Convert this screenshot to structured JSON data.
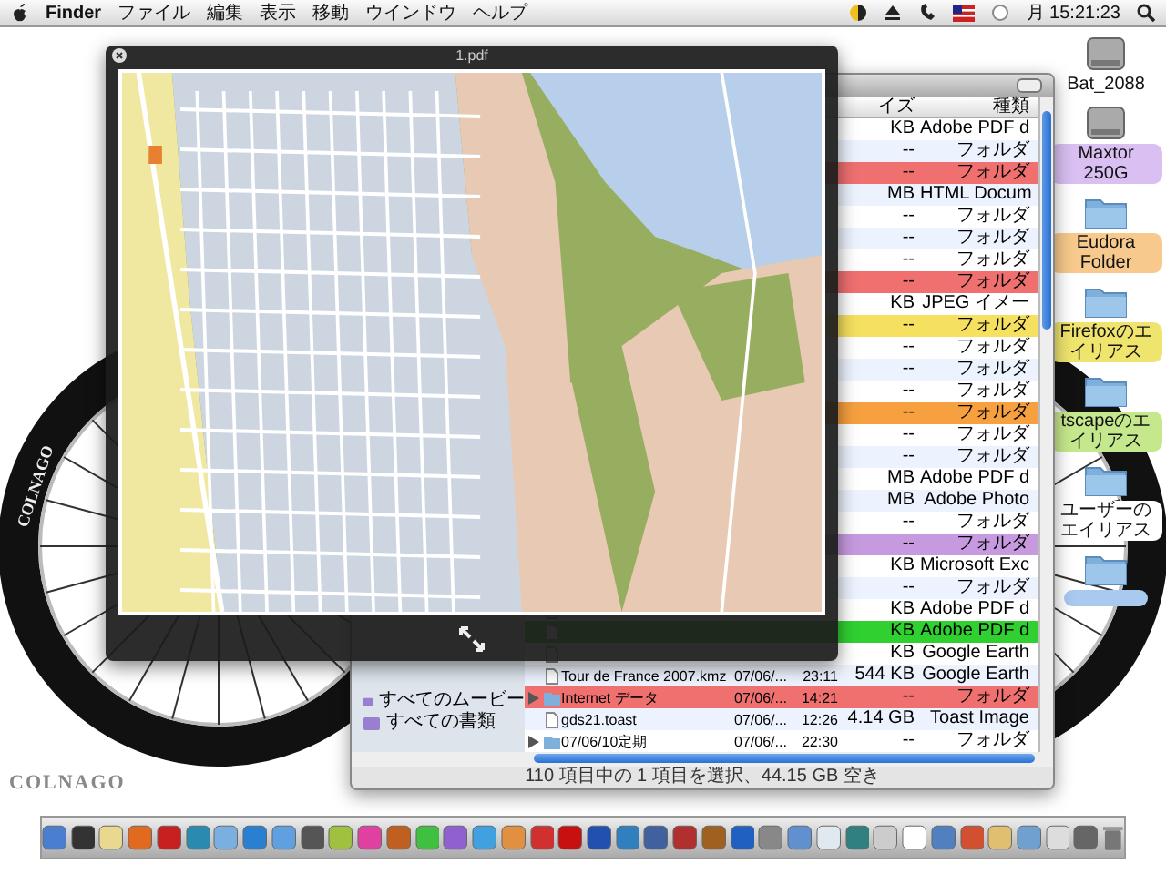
{
  "menubar": {
    "app": "Finder",
    "menus": [
      "ファイル",
      "編集",
      "表示",
      "移動",
      "ウインドウ",
      "ヘルプ"
    ],
    "clock": "月 15:21:23"
  },
  "desktop_icons": [
    {
      "kind": "drive",
      "label": "Bat_2088"
    },
    {
      "kind": "drive",
      "label": "Maxtor 250G",
      "color": "#d9bff2"
    },
    {
      "kind": "folder",
      "label": "Eudora Folder",
      "color": "#f7c98c"
    },
    {
      "kind": "folder",
      "label": "Firefoxのエイリアス",
      "color": "#efe46e"
    },
    {
      "kind": "folder",
      "label": "tscapeのエイリアス",
      "color": "#c6e88c"
    },
    {
      "kind": "folder",
      "label": "ユーザーのエイリアス"
    },
    {
      "kind": "folder",
      "color": "#a9c9ef"
    }
  ],
  "background": {
    "wheel_text": "COLNAGO",
    "logo": "COLNAGO"
  },
  "preview": {
    "title": "1.pdf"
  },
  "finder": {
    "columns": [
      "イズ",
      "種類"
    ],
    "sidebar": [
      {
        "label": "すべてのムービー"
      },
      {
        "label": "すべての書類"
      }
    ],
    "rows": [
      {
        "kind": "file",
        "size": "KB",
        "type": "Adobe PDF d"
      },
      {
        "kind": "folder",
        "size": "--",
        "type": "フォルダ"
      },
      {
        "kind": "folder",
        "size": "--",
        "type": "フォルダ",
        "color": "#f07070"
      },
      {
        "kind": "file",
        "size": "MB",
        "type": "HTML Docum"
      },
      {
        "kind": "folder",
        "size": "--",
        "type": "フォルダ"
      },
      {
        "kind": "folder",
        "size": "--",
        "type": "フォルダ"
      },
      {
        "kind": "folder",
        "size": "--",
        "type": "フォルダ"
      },
      {
        "kind": "folder",
        "size": "--",
        "type": "フォルダ",
        "color": "#f07070"
      },
      {
        "kind": "file",
        "size": "KB",
        "type": "JPEG イメー"
      },
      {
        "kind": "folder",
        "size": "--",
        "type": "フォルダ",
        "color": "#f5e060"
      },
      {
        "kind": "folder",
        "size": "--",
        "type": "フォルダ"
      },
      {
        "kind": "folder",
        "size": "--",
        "type": "フォルダ"
      },
      {
        "kind": "folder",
        "size": "--",
        "type": "フォルダ"
      },
      {
        "kind": "folder",
        "size": "--",
        "type": "フォルダ",
        "color": "#f7a040"
      },
      {
        "kind": "folder",
        "size": "--",
        "type": "フォルダ"
      },
      {
        "kind": "folder",
        "size": "--",
        "type": "フォルダ"
      },
      {
        "kind": "file",
        "size": "MB",
        "type": "Adobe PDF d"
      },
      {
        "kind": "file",
        "size": "MB",
        "type": "Adobe Photo"
      },
      {
        "kind": "folder",
        "size": "--",
        "type": "フォルダ"
      },
      {
        "kind": "folder",
        "size": "--",
        "type": "フォルダ",
        "color": "#c79ae0"
      },
      {
        "kind": "file",
        "size": "KB",
        "type": "Microsoft Exc"
      },
      {
        "kind": "folder",
        "size": "--",
        "type": "フォルダ"
      },
      {
        "kind": "file",
        "size": "KB",
        "type": "Adobe PDF d"
      },
      {
        "kind": "file",
        "size": "KB",
        "type": "Adobe PDF d",
        "color": "#30d030"
      },
      {
        "kind": "file",
        "size": "KB",
        "type": "Google Earth"
      },
      {
        "kind": "file",
        "name": "Tour de France 2007.kmz",
        "date": "07/06/...",
        "time": "23:11",
        "size": "544 KB",
        "type": "Google Earth"
      },
      {
        "kind": "folder",
        "name": "Internet データ",
        "date": "07/06/...",
        "time": "14:21",
        "size": "--",
        "type": "フォルダ",
        "color": "#f07070"
      },
      {
        "kind": "file",
        "name": "gds21.toast",
        "date": "07/06/...",
        "time": "12:26",
        "size": "4.14 GB",
        "type": "Toast Image"
      },
      {
        "kind": "folder",
        "name": "07/06/10定期",
        "date": "07/06/...",
        "time": "22:30",
        "size": "--",
        "type": "フォルダ"
      }
    ],
    "status": "110 項目中の 1 項目を選択、44.15 GB 空き"
  }
}
